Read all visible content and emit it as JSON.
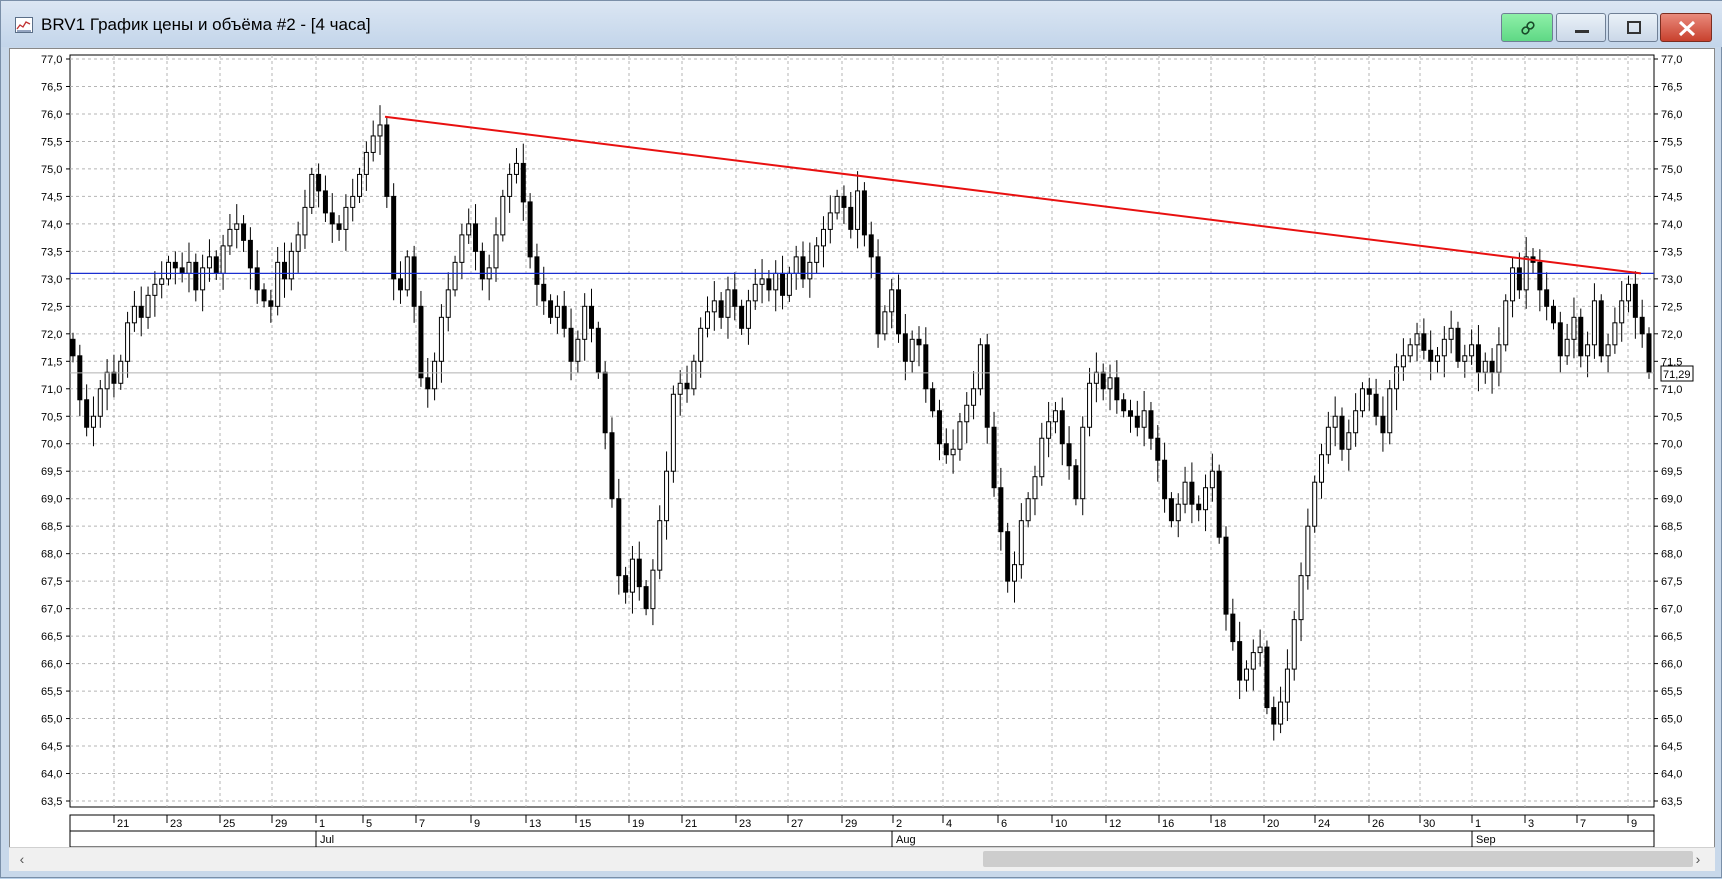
{
  "window": {
    "title": "BRV1 График цены и объёма #2 - [4 часа]",
    "icons": {
      "app": "chart-app-icon",
      "link": "link-icon",
      "minimize": "minimize-icon",
      "maximize": "maximize-icon",
      "close": "close-icon"
    }
  },
  "colors": {
    "up_candle": "#ffffff",
    "down_candle": "#000000",
    "trendline": "#e81010",
    "hline": "#1a2fd0",
    "price_line": "#b0b0b0"
  },
  "chart_data": {
    "type": "candlestick",
    "y_range": [
      63.5,
      77.0
    ],
    "y_ticks": [
      "77,0",
      "76,5",
      "76,0",
      "75,5",
      "75,0",
      "74,5",
      "74,0",
      "73,5",
      "73,0",
      "72,5",
      "72,0",
      "71,5",
      "71,0",
      "70,5",
      "70,0",
      "69,5",
      "69,0",
      "68,5",
      "68,0",
      "67,5",
      "67,0",
      "66,5",
      "66,0",
      "65,5",
      "65,0",
      "64,5",
      "64,0",
      "63,5"
    ],
    "x_day_labels": [
      "21",
      "23",
      "25",
      "29",
      "1",
      "5",
      "7",
      "9",
      "13",
      "15",
      "19",
      "21",
      "23",
      "27",
      "29",
      "2",
      "4",
      "6",
      "10",
      "12",
      "16",
      "18",
      "20",
      "24",
      "26",
      "30",
      "1",
      "3",
      "7",
      "9"
    ],
    "x_month_labels": [
      "Jul",
      "Aug",
      "Sep"
    ],
    "last_price": 71.29,
    "last_price_label": "71,29",
    "horizontal_line": 73.1,
    "trendline": {
      "from": {
        "x": "6 Jul",
        "y": 75.95
      },
      "to": {
        "x": "9 Sep",
        "y": 73.1
      }
    },
    "closes": [
      71.6,
      70.8,
      70.3,
      70.5,
      71.0,
      71.3,
      71.1,
      71.5,
      72.2,
      72.5,
      72.3,
      72.7,
      72.9,
      73.0,
      73.3,
      73.2,
      73.1,
      73.3,
      72.8,
      73.2,
      73.4,
      73.1,
      73.6,
      73.9,
      74.0,
      73.7,
      73.2,
      72.8,
      72.6,
      72.5,
      73.3,
      73.0,
      73.5,
      73.8,
      74.3,
      74.9,
      74.6,
      74.2,
      74.0,
      73.9,
      74.3,
      74.5,
      74.9,
      75.3,
      75.6,
      75.8,
      74.5,
      73.0,
      72.8,
      73.4,
      72.5,
      71.2,
      71.0,
      71.5,
      72.3,
      72.8,
      73.3,
      73.8,
      74.0,
      73.5,
      73.0,
      73.2,
      73.8,
      74.5,
      74.9,
      75.1,
      74.4,
      73.4,
      72.9,
      72.6,
      72.3,
      72.5,
      72.1,
      71.5,
      71.9,
      72.5,
      72.1,
      71.3,
      70.2,
      69.0,
      67.6,
      67.3,
      67.9,
      67.4,
      67.0,
      67.7,
      68.6,
      69.5,
      70.9,
      71.1,
      71.0,
      71.5,
      72.1,
      72.4,
      72.6,
      72.3,
      72.8,
      72.5,
      72.1,
      72.6,
      72.9,
      73.0,
      72.8,
      73.1,
      72.7,
      73.1,
      73.4,
      73.0,
      73.3,
      73.6,
      73.9,
      74.2,
      74.5,
      74.3,
      73.9,
      74.6,
      73.8,
      73.4,
      72.0,
      72.4,
      72.8,
      72.0,
      71.5,
      71.9,
      71.8,
      71.0,
      70.6,
      70.0,
      69.8,
      69.9,
      70.4,
      70.7,
      71.0,
      71.8,
      70.3,
      69.2,
      68.4,
      67.5,
      67.8,
      68.6,
      69.0,
      69.4,
      70.1,
      70.4,
      70.6,
      70.0,
      69.6,
      69.0,
      70.3,
      71.1,
      71.3,
      71.0,
      71.2,
      70.8,
      70.6,
      70.5,
      70.3,
      70.6,
      70.1,
      69.7,
      69.0,
      68.6,
      68.9,
      69.3,
      68.9,
      68.8,
      69.2,
      69.5,
      68.3,
      66.9,
      66.4,
      65.7,
      65.9,
      66.2,
      66.3,
      65.2,
      64.9,
      65.3,
      65.9,
      66.8,
      67.6,
      68.5,
      69.3,
      69.8,
      70.3,
      70.5,
      69.9,
      70.2,
      70.6,
      71.0,
      70.9,
      70.5,
      70.2,
      71.0,
      71.4,
      71.6,
      71.8,
      72.0,
      71.7,
      71.5,
      71.6,
      71.9,
      72.1,
      71.5,
      71.6,
      71.8,
      71.3,
      71.5,
      71.3,
      71.8,
      72.6,
      73.2,
      72.8,
      73.4,
      73.3,
      72.8,
      72.5,
      72.2,
      71.6,
      71.9,
      72.3,
      71.6,
      71.8,
      72.6,
      71.6,
      71.8,
      72.2,
      72.6,
      72.9,
      72.3,
      72.0,
      71.3
    ]
  }
}
